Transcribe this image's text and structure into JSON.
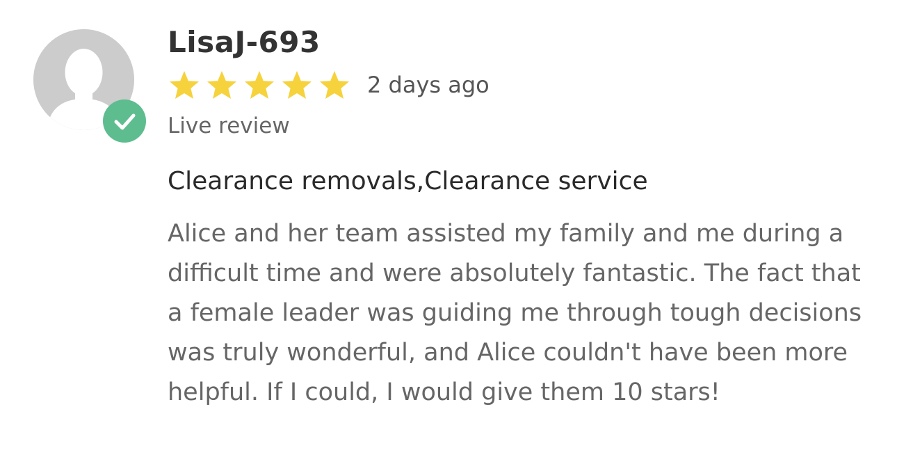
{
  "reviewer": {
    "name": "LisaJ-693",
    "verified": true
  },
  "rating": {
    "stars": 5,
    "max": 5,
    "star_color": "#f6d23c"
  },
  "review": {
    "date": "2 days ago",
    "type": "Live review",
    "title": "Clearance removals,Clearance service",
    "body": "Alice and her team assisted my family and me during a difficult time and were absolutely fantastic. The fact that a female leader was guiding me through tough decisions was truly wonderful, and Alice couldn't have been more helpful. If I could, I would give them 10 stars!"
  },
  "colors": {
    "avatar_bg": "#cccccc",
    "avatar_silhouette": "#ffffff",
    "verified_badge": "#5dbd8f"
  },
  "icons": {
    "avatar": "default-user-silhouette-icon",
    "verified": "check-icon",
    "star": "star-icon"
  }
}
